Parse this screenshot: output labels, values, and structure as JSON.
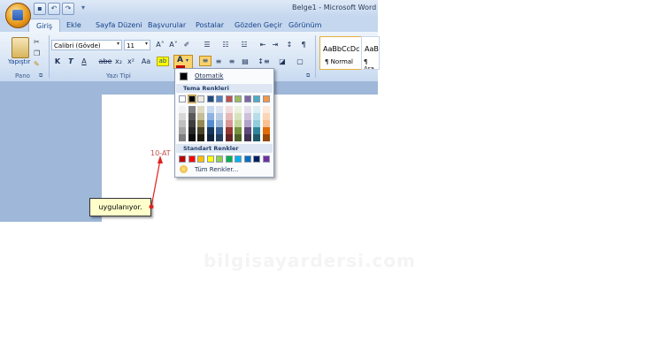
{
  "window": {
    "title": "Belge1 - Microsoft Word"
  },
  "quick_access": [
    "save-icon",
    "undo-icon",
    "redo-icon"
  ],
  "tabs": [
    {
      "label": "Giriş"
    },
    {
      "label": "Ekle"
    },
    {
      "label": "Sayfa Düzeni"
    },
    {
      "label": "Başvurular"
    },
    {
      "label": "Postalar"
    },
    {
      "label": "Gözden Geçir"
    },
    {
      "label": "Görünüm"
    }
  ],
  "ribbon": {
    "clipboard": {
      "paste_label": "Yapıştır",
      "group_label": "Pano"
    },
    "font": {
      "font_name": "Calibri (Gövde)",
      "font_size": "11",
      "group_label": "Yazı Tipi",
      "bold": "K",
      "italic": "T",
      "underline": "A",
      "strike": "abe",
      "subscript": "x₂",
      "superscript": "x²",
      "case": "Aa",
      "font_color": "A"
    },
    "styles": [
      {
        "preview": "AaBbCcDc",
        "name": "¶ Normal"
      },
      {
        "preview": "AaB",
        "name": "¶ Ara"
      }
    ]
  },
  "color_menu": {
    "auto_label": "Otomatik",
    "theme_header": "Tema Renkleri",
    "standard_header": "Standart Renkler",
    "more_label": "Tüm Renkler...",
    "theme_top": [
      "#ffffff",
      "#000000",
      "#eeece1",
      "#1f497d",
      "#4f81bd",
      "#c0504d",
      "#9bbb59",
      "#8064a2",
      "#4bacc6",
      "#f79646"
    ],
    "theme_shades": [
      [
        "#f2f2f2",
        "#d8d8d8",
        "#bfbfbf",
        "#a5a5a5",
        "#7f7f7f"
      ],
      [
        "#7f7f7f",
        "#595959",
        "#3f3f3f",
        "#262626",
        "#0c0c0c"
      ],
      [
        "#ddd9c3",
        "#c4bd97",
        "#938953",
        "#494429",
        "#1d1b10"
      ],
      [
        "#c6d9f0",
        "#8db3e2",
        "#548dd4",
        "#17365d",
        "#0f243e"
      ],
      [
        "#dbe5f1",
        "#b8cce4",
        "#95b3d7",
        "#366092",
        "#244061"
      ],
      [
        "#f2dcdb",
        "#e5b9b7",
        "#d99694",
        "#953734",
        "#632423"
      ],
      [
        "#ebf1dd",
        "#d7e3bc",
        "#c3d69b",
        "#76923c",
        "#4f6128"
      ],
      [
        "#e5e0ec",
        "#ccc1d9",
        "#b2a2c7",
        "#5f497a",
        "#3f3151"
      ],
      [
        "#dbeef3",
        "#b7dde8",
        "#92cddc",
        "#31859b",
        "#205867"
      ],
      [
        "#fdeada",
        "#fbd5b5",
        "#fac08f",
        "#e36c09",
        "#974806"
      ]
    ],
    "standard": [
      "#c00000",
      "#ff0000",
      "#ffc000",
      "#ffff00",
      "#92d050",
      "#00b050",
      "#00b0f0",
      "#0070c0",
      "#002060",
      "#7030a0"
    ]
  },
  "document": {
    "partial_text": "10-AT"
  },
  "callout": {
    "text": "uygulanıyor."
  },
  "watermark": "bilgisayardersi.com",
  "colors": {
    "arrow": "#e0201c",
    "page_bg": "#9fb7d8"
  }
}
